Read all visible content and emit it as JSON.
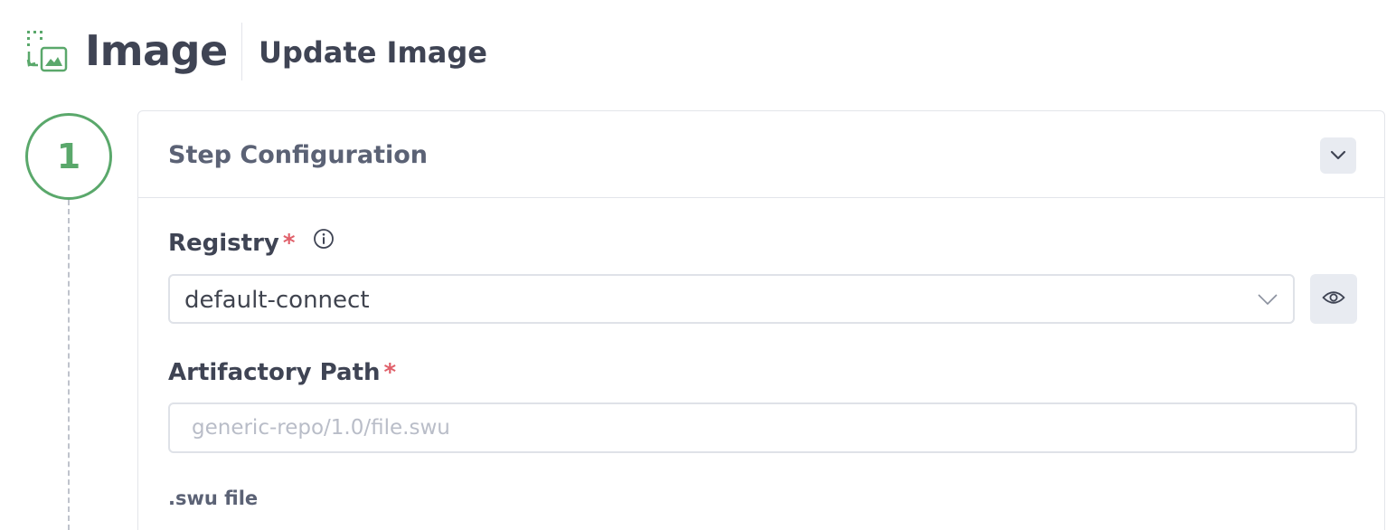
{
  "header": {
    "app_icon": "image-transfer-icon",
    "app_title": "Image",
    "page_subtitle": "Update Image"
  },
  "step": {
    "number": "1",
    "accent_color": "#5aa86b"
  },
  "card": {
    "title": "Step Configuration",
    "collapse_icon": "chevron-down-icon"
  },
  "registry": {
    "label": "Registry",
    "required_mark": "*",
    "info_icon": "info-icon",
    "value": "default-connect",
    "dropdown_icon": "chevron-down-icon",
    "view_icon": "eye-icon"
  },
  "artifactory_path": {
    "label": "Artifactory Path",
    "required_mark": "*",
    "value": "",
    "placeholder": "generic-repo/1.0/file.swu"
  },
  "file_type": {
    "label": ".swu file"
  },
  "colors": {
    "required": "#e0606a",
    "border": "#dfe2e8",
    "button_bg": "#e8ebf1"
  }
}
